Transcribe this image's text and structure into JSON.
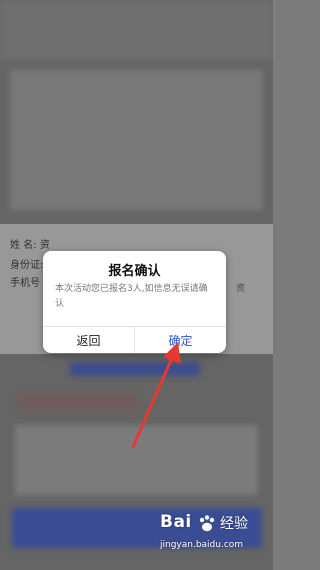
{
  "background_form": {
    "name_label": "姓 名:",
    "name_value": "资",
    "id_label": "身份证:",
    "phone_label": "手机号",
    "side_text": "资"
  },
  "dialog": {
    "title": "报名确认",
    "message": "本次活动您已报名3人,如信息无误请确认",
    "cancel_label": "返回",
    "confirm_label": "确定"
  },
  "watermark": {
    "logo_text": "Bai",
    "logo_suffix": "经验",
    "url": "jingyan.baidu.com"
  },
  "colors": {
    "confirm": "#2b53c9",
    "arrow": "#e53a32"
  }
}
